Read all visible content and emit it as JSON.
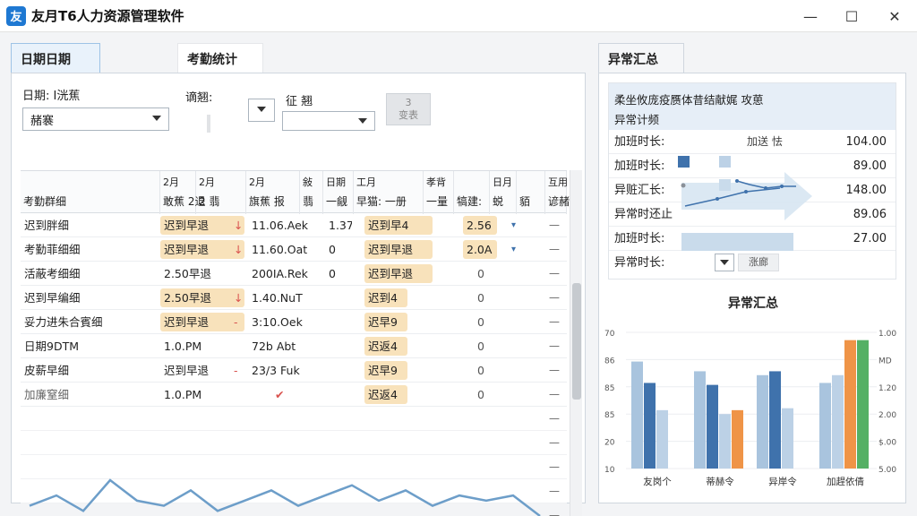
{
  "window": {
    "app_icon": "友",
    "title": "友月T6人力资源管理软件",
    "minimize": "—",
    "maximize": "☐",
    "close": "✕"
  },
  "left": {
    "tab_date": "日期日期",
    "tab_stats": "考勤统计",
    "filters": {
      "date_label": "日期: I洸蕉",
      "date_select": "赭褰",
      "query_label": "谪翘:",
      "status_label": "征 翘",
      "status_select": "",
      "action_button_line1": "3",
      "action_button_line2": "变表"
    },
    "columns": [
      {
        "top": "",
        "label": "考勤群细"
      },
      {
        "top": "2月",
        "label": "敢蕉 2退"
      },
      {
        "top": "2月",
        "label": "2 翡"
      },
      {
        "top": "2月",
        "label": "旗蕉 报"
      },
      {
        "top": "敍",
        "label": "翡"
      },
      {
        "top": "日期",
        "label": "一觎"
      },
      {
        "top": "工月",
        "label": "早猫: 一册"
      },
      {
        "top": "孝背",
        "label": "一量"
      },
      {
        "top": "",
        "label": "犒建:"
      },
      {
        "top": "日月",
        "label": "蜕"
      },
      {
        "top": "",
        "label": "貊"
      },
      {
        "top": "互用",
        "label": "谚赭"
      }
    ],
    "rows": [
      {
        "name": "迟到胖细",
        "status": "迟到早退",
        "arrow": "↓",
        "time": "11.06.Aek",
        "num": "1.37",
        "tag": "迟到早4",
        "val": "2.56",
        "mark": "▾",
        "dash": "—",
        "tagged": true,
        "valtag": true
      },
      {
        "name": "考勤菲细细",
        "status": "迟到早退",
        "arrow": "↓",
        "time": "11.60.Oat",
        "num": "0",
        "tag": "迟到早退",
        "val": "2.0A",
        "mark": "▾",
        "dash": "—",
        "tagged": true,
        "valtag": true
      },
      {
        "name": "活蔽考细细",
        "status": "2.50早退",
        "arrow": "",
        "time": "200IA.Rek",
        "num": "0",
        "tag": "迟到早退",
        "val": "0",
        "mark": "",
        "dash": "—",
        "tagged": false,
        "valtag": false
      },
      {
        "name": "迟到早编细",
        "status": "2.50早退",
        "arrow": "↓",
        "time": "1.40.NuT",
        "num": "",
        "tag": "迟到4",
        "val": "0",
        "mark": "",
        "dash": "—",
        "tagged": true,
        "valtag": false
      },
      {
        "name": "妥力进朱合賓细",
        "status": "迟到早退",
        "arrow": "-",
        "time": "3:10.Oek",
        "num": "",
        "tag": "迟早9",
        "val": "0",
        "mark": "",
        "dash": "—",
        "tagged": true,
        "valtag": false
      },
      {
        "name": "日期9DTM",
        "status": "1.0.PM",
        "arrow": "",
        "time": "72b Abt",
        "num": "",
        "tag": "迟返4",
        "val": "0",
        "mark": "",
        "dash": "—",
        "tagged": false,
        "valtag": false
      },
      {
        "name": "皮薪早细",
        "status": "迟到早退",
        "arrow": "-",
        "time": "23/3 Fuk",
        "num": "",
        "tag": "迟早9",
        "val": "0",
        "mark": "",
        "dash": "—",
        "tagged": false,
        "valtag": false
      },
      {
        "name": "加廉窒细",
        "status": "1.0.PM",
        "arrow": "",
        "time": "✔",
        "num": "",
        "tag": "迟返4",
        "val": "0",
        "mark": "",
        "dash": "—",
        "tagged": false,
        "valtag": false
      }
    ],
    "empty_dashes": [
      "—",
      "—",
      "—",
      "—",
      "—"
    ],
    "sparkline": {
      "color": "#6d9ec9",
      "values": [
        3,
        5,
        2,
        8,
        4,
        3,
        6,
        2,
        4,
        6,
        3,
        5,
        7,
        4,
        6,
        3,
        5,
        4,
        5,
        1
      ]
    }
  },
  "right": {
    "tab": "异常汇总",
    "summary_head_line1": "柔坐攸庞疫赝体昔结献娓 攻葸",
    "summary_head_line2": "异常计频",
    "summary_rows": [
      {
        "label": "加班时长:",
        "legend": "加送 怯",
        "value": "104.00"
      },
      {
        "label": "加班时长:",
        "legend": "",
        "value": "89.00"
      },
      {
        "label": "异赃汇长:",
        "legend": "",
        "value": "148.00"
      },
      {
        "label": "异常时还止",
        "legend": "",
        "value": "89.06"
      },
      {
        "label": "加班时长:",
        "legend": "",
        "value": "27.00"
      }
    ],
    "last_row_label": "异常时长:",
    "last_row_select": "涨廊",
    "chart_title": "异常汇总",
    "chart_data": {
      "type": "bar",
      "title": "异常汇总",
      "categories": [
        "友岗个",
        "蒂赫令",
        "异岸令",
        "加趕依倩"
      ],
      "series": [
        {
          "name": "",
          "color": "#a9c4de",
          "values": [
            55,
            50,
            48,
            44
          ]
        },
        {
          "name": "",
          "color": "#3f72ac",
          "values": [
            44,
            43,
            50,
            0
          ]
        },
        {
          "name": "",
          "color": "#bcd1e6",
          "values": [
            30,
            28,
            31,
            48
          ]
        },
        {
          "name": "",
          "color": "#ef9447",
          "values": [
            0,
            30,
            0,
            66
          ]
        },
        {
          "name": "",
          "color": "#55b065",
          "values": [
            0,
            0,
            0,
            66
          ]
        }
      ],
      "left_ticks": [
        "10",
        "20",
        "85",
        "85",
        "86",
        "70"
      ],
      "right_ticks": [
        "5.00",
        "$.00",
        "2.00",
        "1.20",
        "MD",
        "1.00"
      ],
      "ylim": [
        0,
        70
      ]
    }
  }
}
